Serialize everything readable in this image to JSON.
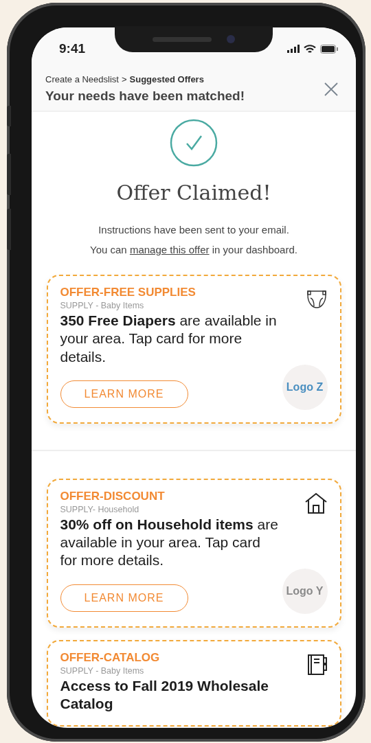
{
  "status_bar": {
    "time": "9:41"
  },
  "header": {
    "breadcrumb": [
      {
        "label": "Create a Needslist",
        "current": false
      },
      {
        "label": "Suggested Offers",
        "current": true
      }
    ],
    "separator": ">",
    "title": "Your needs have been matched!"
  },
  "confirmation": {
    "heading": "Offer Claimed!",
    "lines": [
      {
        "text": "Instructions have been sent to your email."
      },
      {
        "before": "You can",
        "link": "manage this offer",
        "after": "in your dashboard."
      }
    ]
  },
  "offers": [
    {
      "kind": "diaper",
      "label": "OFFER-FREE SUPPLIES",
      "category": "SUPPLY - Baby Items",
      "description": "**350 Free Diapers** are available in your area. Tap card for more details.",
      "button": "LEARN MORE",
      "logo": {
        "text": "Logo Z",
        "color": "#4a8fc0"
      }
    },
    {
      "kind": "house",
      "label": "OFFER-DISCOUNT",
      "category": "SUPPLY- Household",
      "description": "**30% off on Household items** are available in your area. Tap card for more details.",
      "button": "LEARN MORE",
      "logo": {
        "text": "Logo Y",
        "color": "#8a8a8a"
      }
    },
    {
      "kind": "notebook",
      "label": "OFFER-CATALOG",
      "category": "SUPPLY - Baby Items",
      "headline": "Access to Fall 2019 Wholesale Catalog"
    }
  ]
}
